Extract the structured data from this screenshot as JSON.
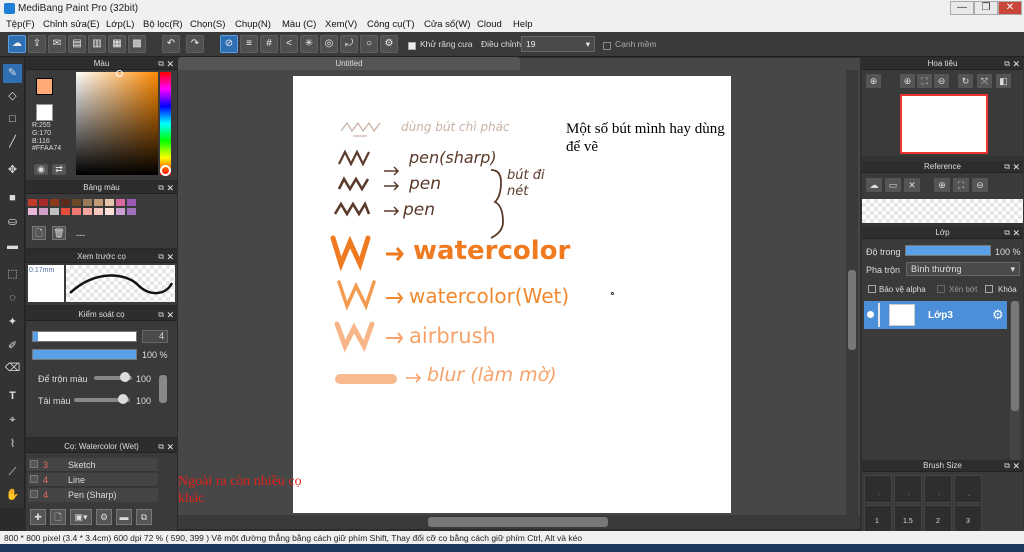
{
  "window": {
    "title": "MediBang Paint Pro (32bit)",
    "min": "—",
    "max": "❐",
    "close": "✕"
  },
  "menu": [
    "Tệp(F)",
    "Chỉnh sửa(E)",
    "Lớp(L)",
    "Bộ lọc(R)",
    "Chọn(S)",
    "Chụp(N)",
    "Màu (C)",
    "Xem(V)",
    "Công cụ(T)",
    "Cửa sổ(W)",
    "Cloud",
    "Help"
  ],
  "toolbar": {
    "antialias_label": "Khử răng cưa",
    "adjust_label": "Điều chỉnh",
    "adjust_value": "19",
    "edge_label": "Cạnh mềm"
  },
  "color_panel": {
    "title": "Màu",
    "r": "R:255",
    "g": "G:170",
    "b": "B:116",
    "hex": "#FFAA74",
    "fg": "#FFAA74"
  },
  "palette_panel": {
    "title": "Bảng màu",
    "value": "---"
  },
  "preview_panel": {
    "title": "Xem trước cọ",
    "size": "0.17mm"
  },
  "brush_control": {
    "title": "Kiểm soát cọ",
    "size": "4",
    "opacity": "100 %",
    "blend_label": "Để trộn màu",
    "blend_value": "100",
    "paint_label": "Tải màu",
    "paint_value": "100"
  },
  "brush_list": {
    "title": "Cọ: Watercolor (Wet)",
    "items": [
      {
        "num": "3",
        "name": "Sketch"
      },
      {
        "num": "4",
        "name": "Line"
      },
      {
        "num": "4",
        "name": "Pen (Sharp)"
      }
    ]
  },
  "document": {
    "tab": "Untitled"
  },
  "annotations": {
    "note_top": "Một số bút mình hay dùng để vẽ",
    "note_bottom": "Ngoài ra còn nhiều cọ khác"
  },
  "canvas_text": {
    "l1": "dùng bút chì phác",
    "l2": "pen(sharp)",
    "l3": "pen",
    "l4": "pen",
    "brace": "bút đi nét",
    "l5": "watercolor",
    "l6": "watercolor(Wet)",
    "l7": "airbrush",
    "l8": "blur (làm mờ)"
  },
  "navigator": {
    "title": "Hoa tiêu"
  },
  "reference": {
    "title": "Reference"
  },
  "layers": {
    "title": "Lớp",
    "opacity_label": "Độ trong",
    "opacity_value": "100 %",
    "blend_label": "Pha trộn",
    "blend_value": "Bình thường",
    "protect_alpha": "Bảo vệ alpha",
    "clip": "Xén bớt",
    "lock": "Khóa",
    "layer_name": "Lớp3"
  },
  "brush_size": {
    "title": "Brush Size",
    "sizes": [
      "1",
      "1.5",
      "2",
      "3"
    ]
  },
  "status": "800 * 800 pixel  (3.4 * 3.4cm)  600 dpi  72 %  ( 590, 399 )  Vẽ một đường thẳng bằng cách giữ phím Shift, Thay đổi cỡ cọ bằng cách giữ phím Ctrl, Alt và kéo",
  "colors": {
    "accent": "#2f6fb3",
    "orange": "#f07a1f",
    "brown": "#5a3a2a",
    "light_orange": "#f6a26a",
    "red_note": "#e0231c"
  }
}
